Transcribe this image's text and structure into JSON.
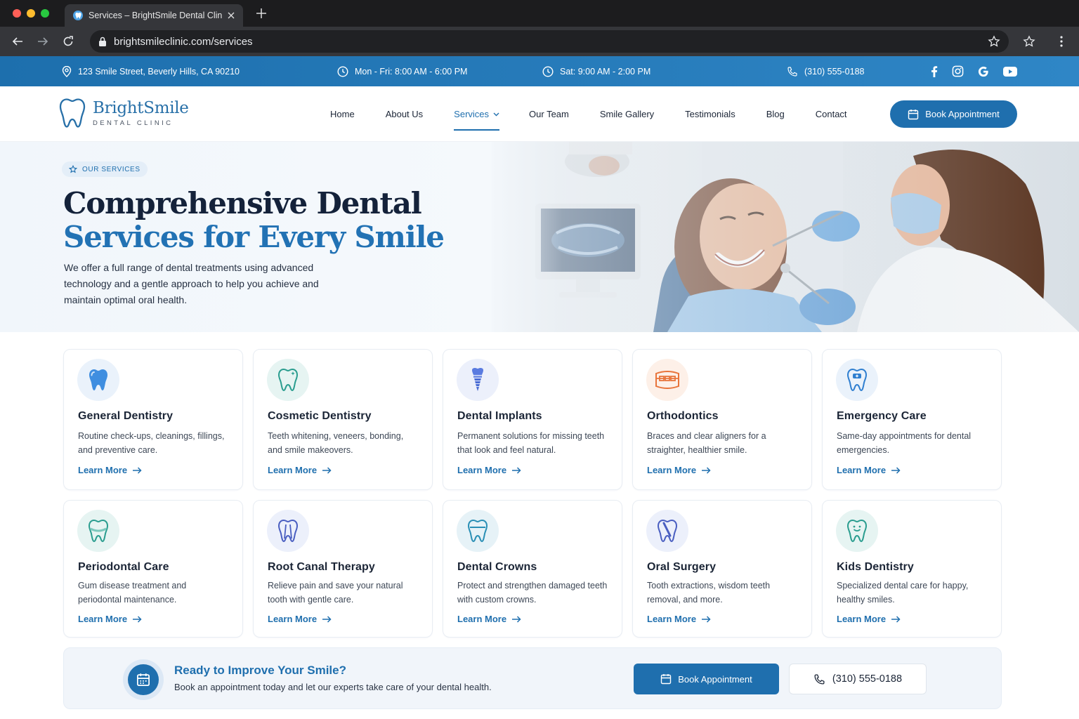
{
  "browser": {
    "tab_title": "Services – BrightSmile Dental Clinic",
    "url": "brightsmileclinic.com/services"
  },
  "infobar": {
    "address": "123 Smile Street, Beverly Hills, CA 90210",
    "hours_weekday": "Mon - Fri: 8:00 AM - 6:00 PM",
    "hours_saturday": "Sat: 9:00 AM - 2:00 PM",
    "phone": "(310) 555-0188",
    "socials": [
      "facebook-icon",
      "instagram-icon",
      "google-icon",
      "youtube-icon"
    ]
  },
  "header": {
    "logo_name": "BrightSmile",
    "logo_sub": "DENTAL CLINIC",
    "nav": [
      "Home",
      "About Us",
      "Services",
      "Our Team",
      "Smile Gallery",
      "Testimonials",
      "Blog",
      "Contact"
    ],
    "active_nav": "Services",
    "book_label": "Book Appointment"
  },
  "hero": {
    "badge": "OUR SERVICES",
    "title_line1": "Comprehensive Dental",
    "title_line2": "Services for Every Smile",
    "paragraph": "We offer a full range of dental treatments using advanced technology and a gentle approach to help you achieve and maintain optimal oral health."
  },
  "services": [
    {
      "title": "General Dentistry",
      "desc": "Routine check-ups, cleanings, fillings, and preventive care.",
      "link": "Learn More",
      "icon": "tooth-icon",
      "color": "#2f7fd0",
      "bg": "#eaf2fb"
    },
    {
      "title": "Cosmetic Dentistry",
      "desc": "Teeth whitening, veneers, bonding, and smile makeovers.",
      "link": "Learn More",
      "icon": "sparkle-tooth-icon",
      "color": "#2a9d8f",
      "bg": "#e6f4f2"
    },
    {
      "title": "Dental Implants",
      "desc": "Permanent solutions for missing teeth that look and feel natural.",
      "link": "Learn More",
      "icon": "implant-icon",
      "color": "#4a6cd4",
      "bg": "#ecf0fb"
    },
    {
      "title": "Orthodontics",
      "desc": "Braces and clear aligners for a straighter, healthier smile.",
      "link": "Learn More",
      "icon": "braces-icon",
      "color": "#e8743b",
      "bg": "#fdf0e8"
    },
    {
      "title": "Emergency Care",
      "desc": "Same-day appointments for dental emergencies.",
      "link": "Learn More",
      "icon": "emergency-tooth-icon",
      "color": "#2f7fd0",
      "bg": "#eaf2fb"
    },
    {
      "title": "Periodontal Care",
      "desc": "Gum disease treatment and periodontal maintenance.",
      "link": "Learn More",
      "icon": "gum-tooth-icon",
      "color": "#2a9d8f",
      "bg": "#e6f4f2"
    },
    {
      "title": "Root Canal Therapy",
      "desc": "Relieve pain and save your natural tooth with gentle care.",
      "link": "Learn More",
      "icon": "root-canal-icon",
      "color": "#4a5fc1",
      "bg": "#ecf0fb"
    },
    {
      "title": "Dental Crowns",
      "desc": "Protect and strengthen damaged teeth with custom crowns.",
      "link": "Learn More",
      "icon": "crown-tooth-icon",
      "color": "#2a8fb5",
      "bg": "#e6f2f7"
    },
    {
      "title": "Oral Surgery",
      "desc": "Tooth extractions, wisdom teeth removal, and more.",
      "link": "Learn More",
      "icon": "surgery-tooth-icon",
      "color": "#4a5fc1",
      "bg": "#ecf0fb"
    },
    {
      "title": "Kids Dentistry",
      "desc": "Specialized dental care for happy, healthy smiles.",
      "link": "Learn More",
      "icon": "smiling-tooth-icon",
      "color": "#2a9d8f",
      "bg": "#e6f4f2"
    }
  ],
  "cta": {
    "title": "Ready to Improve Your Smile?",
    "subtitle": "Book an appointment today and let our experts take care of your dental health.",
    "book_label": "Book Appointment",
    "phone": "(310) 555-0188"
  },
  "colors": {
    "brand": "#1f6fae",
    "infobar": "#2a7dbd"
  }
}
